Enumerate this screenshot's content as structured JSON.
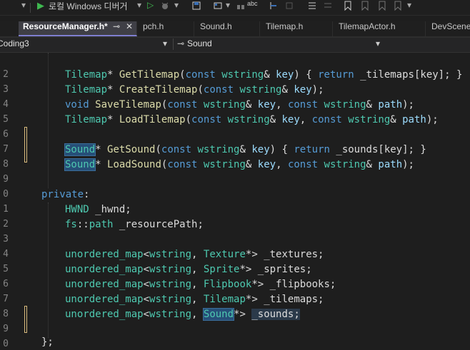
{
  "toolbar": {
    "run_label": "로컬 Windows 디버거",
    "play_glyph": "▶",
    "dropdown_glyph": "▾",
    "icons": [
      "play-icon",
      "play-outline-icon",
      "bug-icon",
      "save-icon",
      "build-icon",
      "spellcheck-icon",
      "step-icon",
      "list-icon",
      "bookmark-icon",
      "bookmark-prev-icon",
      "bookmark-next-icon",
      "bookmark-clear-icon"
    ]
  },
  "tabs": [
    {
      "label": "ResourceManager.h*",
      "pin": "⊸",
      "close": "✕"
    },
    {
      "label": "pch.h"
    },
    {
      "label": "Sound.h"
    },
    {
      "label": "Tilemap.h"
    },
    {
      "label": "TilemapActor.h"
    },
    {
      "label": "DevScene"
    }
  ],
  "navbar": {
    "project": "Coding3",
    "member": "Sound",
    "arrow": "▾"
  },
  "gutter": [
    "",
    "2",
    "3",
    "4",
    "5",
    "6",
    "7",
    "8",
    "9",
    "0",
    "1",
    "2",
    "3",
    "4",
    "5",
    "6",
    "7",
    "8",
    "9",
    "0"
  ],
  "code": {
    "l1": "",
    "l2_type": "Tilemap",
    "l2_fn": "GetTilemap",
    "l2_kw1": "const",
    "l2_ty": "wstring",
    "l2_p": "key",
    "l2_kw2": "return",
    "l2_rest": "_tilemaps[key]; }",
    "l3_type": "Tilemap",
    "l3_fn": "CreateTilemap",
    "l3_kw": "const",
    "l3_ty": "wstring",
    "l3_p": "key",
    "l4_kw": "void",
    "l4_fn": "SaveTilemap",
    "l4_kw1": "const",
    "l4_ty1": "wstring",
    "l4_p1": "key",
    "l4_kw2": "const",
    "l4_ty2": "wstring",
    "l4_p2": "path",
    "l5_type": "Tilemap",
    "l5_fn": "LoadTilemap",
    "l5_kw1": "const",
    "l5_ty1": "wstring",
    "l5_p1": "key",
    "l5_kw2": "const",
    "l5_ty2": "wstring",
    "l5_p2": "path",
    "l7_type": "Sound",
    "l7_fn": "GetSound",
    "l7_kw1": "const",
    "l7_ty": "wstring",
    "l7_p": "key",
    "l7_kw2": "return",
    "l7_rest": "_sounds[key]; }",
    "l8_type": "Sound",
    "l8_fn": "LoadSound",
    "l8_kw1": "const",
    "l8_ty1": "wstring",
    "l8_p1": "key",
    "l8_kw2": "const",
    "l8_ty2": "wstring",
    "l8_p2": "path",
    "l10_kw": "private",
    "l11_type": "HWND",
    "l11_rest": " _hwnd;",
    "l12_ns": "fs",
    "l12_type": "path",
    "l12_rest": " _resourcePath;",
    "map": "unordered_map",
    "wstring": "wstring",
    "maps": [
      {
        "type": "Texture",
        "name": "_textures;"
      },
      {
        "type": "Sprite",
        "name": "_sprites;"
      },
      {
        "type": "Flipbook",
        "name": "_flipbooks;"
      },
      {
        "type": "Tilemap",
        "name": "_tilemaps;"
      },
      {
        "type": "Sound",
        "name": "_sounds;"
      }
    ],
    "l20": "};"
  }
}
